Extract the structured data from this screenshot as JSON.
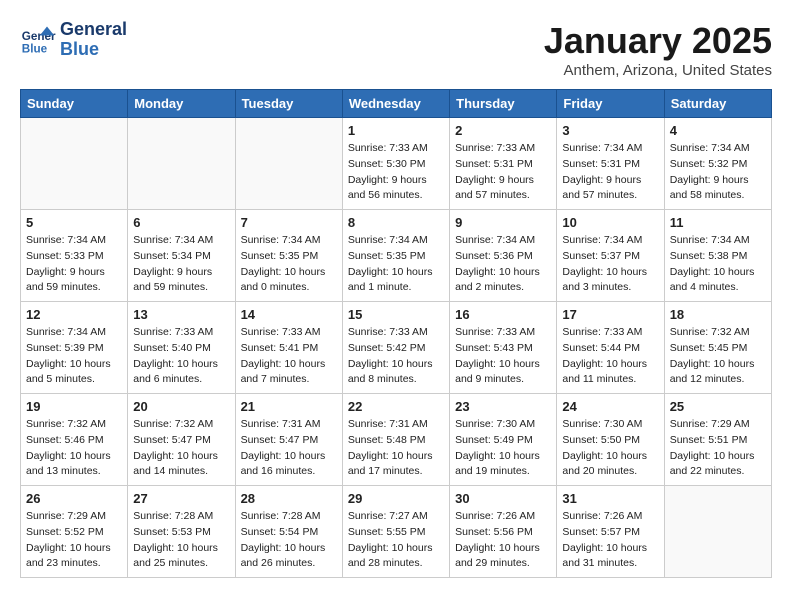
{
  "logo": {
    "line1": "General",
    "line2": "Blue"
  },
  "title": "January 2025",
  "subtitle": "Anthem, Arizona, United States",
  "weekdays": [
    "Sunday",
    "Monday",
    "Tuesday",
    "Wednesday",
    "Thursday",
    "Friday",
    "Saturday"
  ],
  "weeks": [
    [
      {
        "day": "",
        "info": ""
      },
      {
        "day": "",
        "info": ""
      },
      {
        "day": "",
        "info": ""
      },
      {
        "day": "1",
        "info": "Sunrise: 7:33 AM\nSunset: 5:30 PM\nDaylight: 9 hours\nand 56 minutes."
      },
      {
        "day": "2",
        "info": "Sunrise: 7:33 AM\nSunset: 5:31 PM\nDaylight: 9 hours\nand 57 minutes."
      },
      {
        "day": "3",
        "info": "Sunrise: 7:34 AM\nSunset: 5:31 PM\nDaylight: 9 hours\nand 57 minutes."
      },
      {
        "day": "4",
        "info": "Sunrise: 7:34 AM\nSunset: 5:32 PM\nDaylight: 9 hours\nand 58 minutes."
      }
    ],
    [
      {
        "day": "5",
        "info": "Sunrise: 7:34 AM\nSunset: 5:33 PM\nDaylight: 9 hours\nand 59 minutes."
      },
      {
        "day": "6",
        "info": "Sunrise: 7:34 AM\nSunset: 5:34 PM\nDaylight: 9 hours\nand 59 minutes."
      },
      {
        "day": "7",
        "info": "Sunrise: 7:34 AM\nSunset: 5:35 PM\nDaylight: 10 hours\nand 0 minutes."
      },
      {
        "day": "8",
        "info": "Sunrise: 7:34 AM\nSunset: 5:35 PM\nDaylight: 10 hours\nand 1 minute."
      },
      {
        "day": "9",
        "info": "Sunrise: 7:34 AM\nSunset: 5:36 PM\nDaylight: 10 hours\nand 2 minutes."
      },
      {
        "day": "10",
        "info": "Sunrise: 7:34 AM\nSunset: 5:37 PM\nDaylight: 10 hours\nand 3 minutes."
      },
      {
        "day": "11",
        "info": "Sunrise: 7:34 AM\nSunset: 5:38 PM\nDaylight: 10 hours\nand 4 minutes."
      }
    ],
    [
      {
        "day": "12",
        "info": "Sunrise: 7:34 AM\nSunset: 5:39 PM\nDaylight: 10 hours\nand 5 minutes."
      },
      {
        "day": "13",
        "info": "Sunrise: 7:33 AM\nSunset: 5:40 PM\nDaylight: 10 hours\nand 6 minutes."
      },
      {
        "day": "14",
        "info": "Sunrise: 7:33 AM\nSunset: 5:41 PM\nDaylight: 10 hours\nand 7 minutes."
      },
      {
        "day": "15",
        "info": "Sunrise: 7:33 AM\nSunset: 5:42 PM\nDaylight: 10 hours\nand 8 minutes."
      },
      {
        "day": "16",
        "info": "Sunrise: 7:33 AM\nSunset: 5:43 PM\nDaylight: 10 hours\nand 9 minutes."
      },
      {
        "day": "17",
        "info": "Sunrise: 7:33 AM\nSunset: 5:44 PM\nDaylight: 10 hours\nand 11 minutes."
      },
      {
        "day": "18",
        "info": "Sunrise: 7:32 AM\nSunset: 5:45 PM\nDaylight: 10 hours\nand 12 minutes."
      }
    ],
    [
      {
        "day": "19",
        "info": "Sunrise: 7:32 AM\nSunset: 5:46 PM\nDaylight: 10 hours\nand 13 minutes."
      },
      {
        "day": "20",
        "info": "Sunrise: 7:32 AM\nSunset: 5:47 PM\nDaylight: 10 hours\nand 14 minutes."
      },
      {
        "day": "21",
        "info": "Sunrise: 7:31 AM\nSunset: 5:47 PM\nDaylight: 10 hours\nand 16 minutes."
      },
      {
        "day": "22",
        "info": "Sunrise: 7:31 AM\nSunset: 5:48 PM\nDaylight: 10 hours\nand 17 minutes."
      },
      {
        "day": "23",
        "info": "Sunrise: 7:30 AM\nSunset: 5:49 PM\nDaylight: 10 hours\nand 19 minutes."
      },
      {
        "day": "24",
        "info": "Sunrise: 7:30 AM\nSunset: 5:50 PM\nDaylight: 10 hours\nand 20 minutes."
      },
      {
        "day": "25",
        "info": "Sunrise: 7:29 AM\nSunset: 5:51 PM\nDaylight: 10 hours\nand 22 minutes."
      }
    ],
    [
      {
        "day": "26",
        "info": "Sunrise: 7:29 AM\nSunset: 5:52 PM\nDaylight: 10 hours\nand 23 minutes."
      },
      {
        "day": "27",
        "info": "Sunrise: 7:28 AM\nSunset: 5:53 PM\nDaylight: 10 hours\nand 25 minutes."
      },
      {
        "day": "28",
        "info": "Sunrise: 7:28 AM\nSunset: 5:54 PM\nDaylight: 10 hours\nand 26 minutes."
      },
      {
        "day": "29",
        "info": "Sunrise: 7:27 AM\nSunset: 5:55 PM\nDaylight: 10 hours\nand 28 minutes."
      },
      {
        "day": "30",
        "info": "Sunrise: 7:26 AM\nSunset: 5:56 PM\nDaylight: 10 hours\nand 29 minutes."
      },
      {
        "day": "31",
        "info": "Sunrise: 7:26 AM\nSunset: 5:57 PM\nDaylight: 10 hours\nand 31 minutes."
      },
      {
        "day": "",
        "info": ""
      }
    ]
  ]
}
